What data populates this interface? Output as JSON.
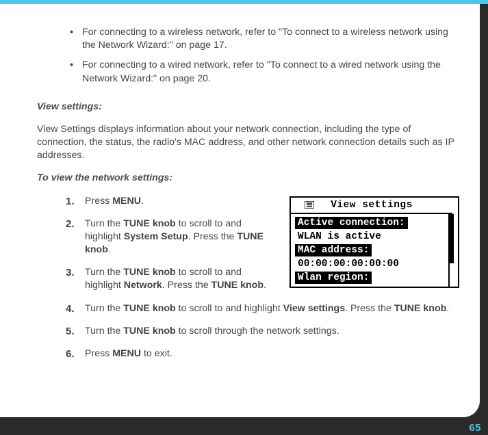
{
  "bullets": [
    {
      "pre": "For connecting to a wireless network, refer to \"To connect to a wireless network using the Network Wizard:\" on page ",
      "page": "17",
      "post": "."
    },
    {
      "pre": "For connecting to a wired network, refer to \"To connect to a wired network using the Network Wizard:\" on page ",
      "page": "20",
      "post": "."
    }
  ],
  "section1": {
    "heading": "View settings:"
  },
  "para1": "View Settings displays information about your network connection, including the type of connection, the status, the radio's MAC address, and other network connection details such as IP addresses.",
  "section2": {
    "heading": "To view the network settings:"
  },
  "steps": {
    "s1": {
      "num": "1.",
      "a": "Press ",
      "b": "MENU",
      "c": "."
    },
    "s2": {
      "num": "2.",
      "a": "Turn the ",
      "b": "TUNE knob",
      "c": " to scroll to and highlight ",
      "d": "System Setup",
      "e": ". Press the ",
      "f": "TUNE knob",
      "g": "."
    },
    "s3": {
      "num": "3.",
      "a": "Turn the ",
      "b": "TUNE knob",
      "c": " to scroll to and highlight ",
      "d": "Network",
      "e": ". Press the ",
      "f": "TUNE knob",
      "g": "."
    },
    "s4": {
      "num": "4.",
      "a": "Turn the ",
      "b": "TUNE knob",
      "c": " to scroll to and highlight ",
      "d": "View settings",
      "e": ". Press the ",
      "f": "TUNE knob",
      "g": "."
    },
    "s5": {
      "num": "5.",
      "a": "Turn the ",
      "b": "TUNE knob",
      "c": " to scroll through the network settings."
    },
    "s6": {
      "num": "6.",
      "a": "Press ",
      "b": "MENU",
      "c": " to exit."
    }
  },
  "display": {
    "title": "View settings",
    "rows": [
      {
        "text": "Active connection:",
        "inv": true
      },
      {
        "text": "WLAN is active",
        "inv": false
      },
      {
        "text": "MAC address:",
        "inv": true
      },
      {
        "text": "00:00:00:00:00:00",
        "inv": false
      },
      {
        "text": "Wlan region:",
        "inv": true
      }
    ]
  },
  "pageNumber": "65"
}
